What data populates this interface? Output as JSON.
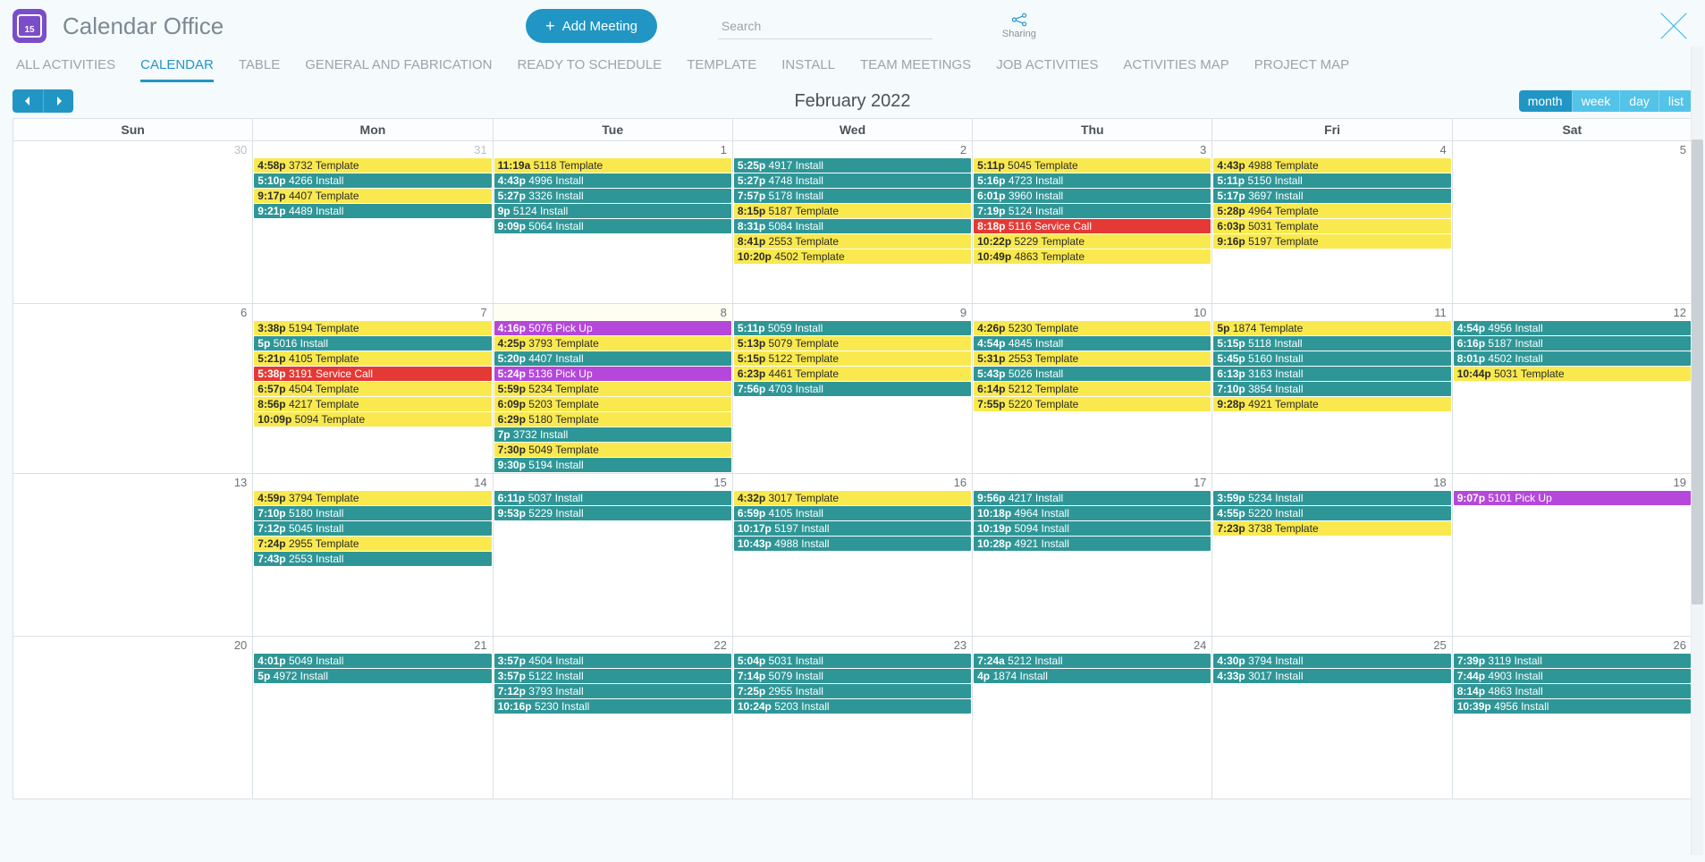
{
  "header": {
    "title": "Calendar Office",
    "logo_num": "15",
    "add_meeting_label": "Add Meeting",
    "search_placeholder": "Search",
    "sharing_label": "Sharing"
  },
  "tabs": [
    {
      "id": "all-activities",
      "label": "ALL ACTIVITIES",
      "active": false
    },
    {
      "id": "calendar",
      "label": "CALENDAR",
      "active": true
    },
    {
      "id": "table",
      "label": "TABLE",
      "active": false
    },
    {
      "id": "general-fabrication",
      "label": "GENERAL AND FABRICATION",
      "active": false
    },
    {
      "id": "ready-schedule",
      "label": "READY TO SCHEDULE",
      "active": false
    },
    {
      "id": "template",
      "label": "TEMPLATE",
      "active": false
    },
    {
      "id": "install",
      "label": "INSTALL",
      "active": false
    },
    {
      "id": "team-meetings",
      "label": "TEAM MEETINGS",
      "active": false
    },
    {
      "id": "job-activities",
      "label": "JOB ACTIVITIES",
      "active": false
    },
    {
      "id": "activities-map",
      "label": "ACTIVITIES MAP",
      "active": false
    },
    {
      "id": "project-map",
      "label": "PROJECT MAP",
      "active": false
    }
  ],
  "toolbar": {
    "month_title": "February 2022",
    "views": [
      {
        "id": "month",
        "label": "month",
        "active": true
      },
      {
        "id": "week",
        "label": "week",
        "active": false
      },
      {
        "id": "day",
        "label": "day",
        "active": false
      },
      {
        "id": "list",
        "label": "list",
        "active": false
      }
    ]
  },
  "day_headers": [
    "Sun",
    "Mon",
    "Tue",
    "Wed",
    "Thu",
    "Fri",
    "Sat"
  ],
  "event_colors": {
    "install": "#2f9697",
    "template": "#f9e94e",
    "service_call": "#e53935",
    "pick_up": "#b548db"
  },
  "weeks": [
    [
      {
        "num": "30",
        "muted": true,
        "events": []
      },
      {
        "num": "31",
        "muted": true,
        "events": [
          {
            "time": "4:58p",
            "title": "3732 Template",
            "type": "template"
          },
          {
            "time": "5:10p",
            "title": "4266 Install",
            "type": "install"
          },
          {
            "time": "9:17p",
            "title": "4407 Template",
            "type": "template"
          },
          {
            "time": "9:21p",
            "title": "4489 Install",
            "type": "install"
          }
        ]
      },
      {
        "num": "1",
        "events": [
          {
            "time": "11:19a",
            "title": "5118 Template",
            "type": "template"
          },
          {
            "time": "4:43p",
            "title": "4996 Install",
            "type": "install"
          },
          {
            "time": "5:27p",
            "title": "3326 Install",
            "type": "install"
          },
          {
            "time": "9p",
            "title": "5124 Install",
            "type": "install"
          },
          {
            "time": "9:09p",
            "title": "5064 Install",
            "type": "install"
          }
        ]
      },
      {
        "num": "2",
        "events": [
          {
            "time": "5:25p",
            "title": "4917 Install",
            "type": "install"
          },
          {
            "time": "5:27p",
            "title": "4748 Install",
            "type": "install"
          },
          {
            "time": "7:57p",
            "title": "5178 Install",
            "type": "install"
          },
          {
            "time": "8:15p",
            "title": "5187 Template",
            "type": "template"
          },
          {
            "time": "8:31p",
            "title": "5084 Install",
            "type": "install"
          },
          {
            "time": "8:41p",
            "title": "2553 Template",
            "type": "template"
          },
          {
            "time": "10:20p",
            "title": "4502 Template",
            "type": "template"
          }
        ]
      },
      {
        "num": "3",
        "events": [
          {
            "time": "5:11p",
            "title": "5045 Template",
            "type": "template"
          },
          {
            "time": "5:16p",
            "title": "4723 Install",
            "type": "install"
          },
          {
            "time": "6:01p",
            "title": "3960 Install",
            "type": "install"
          },
          {
            "time": "7:19p",
            "title": "5124 Install",
            "type": "install"
          },
          {
            "time": "8:18p",
            "title": "5116 Service Call",
            "type": "service"
          },
          {
            "time": "10:22p",
            "title": "5229 Template",
            "type": "template"
          },
          {
            "time": "10:49p",
            "title": "4863 Template",
            "type": "template"
          }
        ]
      },
      {
        "num": "4",
        "events": [
          {
            "time": "4:43p",
            "title": "4988 Template",
            "type": "template"
          },
          {
            "time": "5:11p",
            "title": "5150 Install",
            "type": "install"
          },
          {
            "time": "5:17p",
            "title": "3697 Install",
            "type": "install"
          },
          {
            "time": "5:28p",
            "title": "4964 Template",
            "type": "template"
          },
          {
            "time": "6:03p",
            "title": "5031 Template",
            "type": "template"
          },
          {
            "time": "9:16p",
            "title": "5197 Template",
            "type": "template"
          }
        ]
      },
      {
        "num": "5",
        "events": []
      }
    ],
    [
      {
        "num": "6",
        "events": []
      },
      {
        "num": "7",
        "events": [
          {
            "time": "3:38p",
            "title": "5194 Template",
            "type": "template"
          },
          {
            "time": "5p",
            "title": "5016 Install",
            "type": "install"
          },
          {
            "time": "5:21p",
            "title": "4105 Template",
            "type": "template"
          },
          {
            "time": "5:38p",
            "title": "3191 Service Call",
            "type": "service"
          },
          {
            "time": "6:57p",
            "title": "4504 Template",
            "type": "template"
          },
          {
            "time": "8:56p",
            "title": "4217 Template",
            "type": "template"
          },
          {
            "time": "10:09p",
            "title": "5094 Template",
            "type": "template"
          }
        ]
      },
      {
        "num": "8",
        "today": true,
        "events": [
          {
            "time": "4:16p",
            "title": "5076 Pick Up",
            "type": "pickup"
          },
          {
            "time": "4:25p",
            "title": "3793 Template",
            "type": "template"
          },
          {
            "time": "5:20p",
            "title": "4407 Install",
            "type": "install"
          },
          {
            "time": "5:24p",
            "title": "5136 Pick Up",
            "type": "pickup"
          },
          {
            "time": "5:59p",
            "title": "5234 Template",
            "type": "template"
          },
          {
            "time": "6:09p",
            "title": "5203 Template",
            "type": "template"
          },
          {
            "time": "6:29p",
            "title": "5180 Template",
            "type": "template"
          },
          {
            "time": "7p",
            "title": "3732 Install",
            "type": "install"
          },
          {
            "time": "7:30p",
            "title": "5049 Template",
            "type": "template"
          },
          {
            "time": "9:30p",
            "title": "5194 Install",
            "type": "install"
          }
        ]
      },
      {
        "num": "9",
        "events": [
          {
            "time": "5:11p",
            "title": "5059 Install",
            "type": "install"
          },
          {
            "time": "5:13p",
            "title": "5079 Template",
            "type": "template"
          },
          {
            "time": "5:15p",
            "title": "5122 Template",
            "type": "template"
          },
          {
            "time": "6:23p",
            "title": "4461 Template",
            "type": "template"
          },
          {
            "time": "7:56p",
            "title": "4703 Install",
            "type": "install"
          }
        ]
      },
      {
        "num": "10",
        "events": [
          {
            "time": "4:26p",
            "title": "5230 Template",
            "type": "template"
          },
          {
            "time": "4:54p",
            "title": "4845 Install",
            "type": "install"
          },
          {
            "time": "5:31p",
            "title": "2553 Template",
            "type": "template"
          },
          {
            "time": "5:43p",
            "title": "5026 Install",
            "type": "install"
          },
          {
            "time": "6:14p",
            "title": "5212 Template",
            "type": "template"
          },
          {
            "time": "7:55p",
            "title": "5220 Template",
            "type": "template"
          }
        ]
      },
      {
        "num": "11",
        "events": [
          {
            "time": "5p",
            "title": "1874 Template",
            "type": "template"
          },
          {
            "time": "5:15p",
            "title": "5118 Install",
            "type": "install"
          },
          {
            "time": "5:45p",
            "title": "5160 Install",
            "type": "install"
          },
          {
            "time": "6:13p",
            "title": "3163 Install",
            "type": "install"
          },
          {
            "time": "7:10p",
            "title": "3854 Install",
            "type": "install"
          },
          {
            "time": "9:28p",
            "title": "4921 Template",
            "type": "template"
          }
        ]
      },
      {
        "num": "12",
        "events": [
          {
            "time": "4:54p",
            "title": "4956 Install",
            "type": "install"
          },
          {
            "time": "6:16p",
            "title": "5187 Install",
            "type": "install"
          },
          {
            "time": "8:01p",
            "title": "4502 Install",
            "type": "install"
          },
          {
            "time": "10:44p",
            "title": "5031 Template",
            "type": "template"
          }
        ]
      }
    ],
    [
      {
        "num": "13",
        "events": []
      },
      {
        "num": "14",
        "events": [
          {
            "time": "4:59p",
            "title": "3794 Template",
            "type": "template"
          },
          {
            "time": "7:10p",
            "title": "5180 Install",
            "type": "install"
          },
          {
            "time": "7:12p",
            "title": "5045 Install",
            "type": "install"
          },
          {
            "time": "7:24p",
            "title": "2955 Template",
            "type": "template"
          },
          {
            "time": "7:43p",
            "title": "2553 Install",
            "type": "install"
          }
        ]
      },
      {
        "num": "15",
        "events": [
          {
            "time": "6:11p",
            "title": "5037 Install",
            "type": "install"
          },
          {
            "time": "9:53p",
            "title": "5229 Install",
            "type": "install"
          }
        ]
      },
      {
        "num": "16",
        "events": [
          {
            "time": "4:32p",
            "title": "3017 Template",
            "type": "template"
          },
          {
            "time": "6:59p",
            "title": "4105 Install",
            "type": "install"
          },
          {
            "time": "10:17p",
            "title": "5197 Install",
            "type": "install"
          },
          {
            "time": "10:43p",
            "title": "4988 Install",
            "type": "install"
          }
        ]
      },
      {
        "num": "17",
        "events": [
          {
            "time": "9:56p",
            "title": "4217 Install",
            "type": "install"
          },
          {
            "time": "10:18p",
            "title": "4964 Install",
            "type": "install"
          },
          {
            "time": "10:19p",
            "title": "5094 Install",
            "type": "install"
          },
          {
            "time": "10:28p",
            "title": "4921 Install",
            "type": "install"
          }
        ]
      },
      {
        "num": "18",
        "events": [
          {
            "time": "3:59p",
            "title": "5234 Install",
            "type": "install"
          },
          {
            "time": "4:55p",
            "title": "5220 Install",
            "type": "install"
          },
          {
            "time": "7:23p",
            "title": "3738 Template",
            "type": "template"
          }
        ]
      },
      {
        "num": "19",
        "events": [
          {
            "time": "9:07p",
            "title": "5101 Pick Up",
            "type": "pickup"
          }
        ]
      }
    ],
    [
      {
        "num": "20",
        "events": []
      },
      {
        "num": "21",
        "events": [
          {
            "time": "4:01p",
            "title": "5049 Install",
            "type": "install"
          },
          {
            "time": "5p",
            "title": "4972 Install",
            "type": "install"
          }
        ]
      },
      {
        "num": "22",
        "events": [
          {
            "time": "3:57p",
            "title": "4504 Install",
            "type": "install"
          },
          {
            "time": "3:57p",
            "title": "5122 Install",
            "type": "install"
          },
          {
            "time": "7:12p",
            "title": "3793 Install",
            "type": "install"
          },
          {
            "time": "10:16p",
            "title": "5230 Install",
            "type": "install"
          }
        ]
      },
      {
        "num": "23",
        "events": [
          {
            "time": "5:04p",
            "title": "5031 Install",
            "type": "install"
          },
          {
            "time": "7:14p",
            "title": "5079 Install",
            "type": "install"
          },
          {
            "time": "7:25p",
            "title": "2955 Install",
            "type": "install"
          },
          {
            "time": "10:24p",
            "title": "5203 Install",
            "type": "install"
          }
        ]
      },
      {
        "num": "24",
        "events": [
          {
            "time": "7:24a",
            "title": "5212 Install",
            "type": "install"
          },
          {
            "time": "4p",
            "title": "1874 Install",
            "type": "install"
          }
        ]
      },
      {
        "num": "25",
        "events": [
          {
            "time": "4:30p",
            "title": "3794 Install",
            "type": "install"
          },
          {
            "time": "4:33p",
            "title": "3017 Install",
            "type": "install"
          }
        ]
      },
      {
        "num": "26",
        "events": [
          {
            "time": "7:39p",
            "title": "3119 Install",
            "type": "install"
          },
          {
            "time": "7:44p",
            "title": "4903 Install",
            "type": "install"
          },
          {
            "time": "8:14p",
            "title": "4863 Install",
            "type": "install"
          },
          {
            "time": "10:39p",
            "title": "4956 Install",
            "type": "install"
          }
        ]
      }
    ]
  ]
}
